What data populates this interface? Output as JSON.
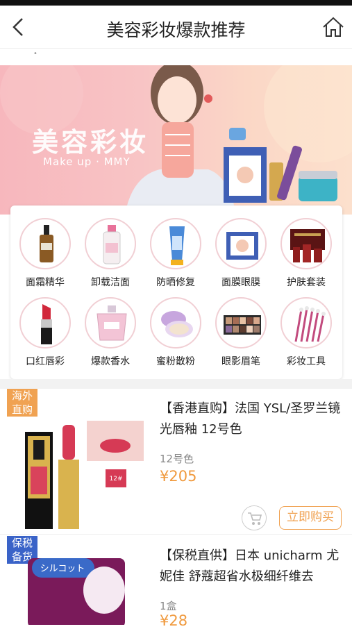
{
  "header": {
    "title": "美容彩妆爆款推荐",
    "back_icon": "chevron-left-icon",
    "home_icon": "home-icon"
  },
  "banner": {
    "title": "美容彩妆",
    "subtitle": "Make up · MMY"
  },
  "categories": [
    {
      "label": "面霜精华",
      "icon": "serum-bottle-icon"
    },
    {
      "label": "卸载洁面",
      "icon": "cleanser-bottle-icon"
    },
    {
      "label": "防晒修复",
      "icon": "sunscreen-tube-icon"
    },
    {
      "label": "面膜眼膜",
      "icon": "face-mask-box-icon"
    },
    {
      "label": "护肤套装",
      "icon": "skincare-set-icon"
    },
    {
      "label": "口红唇彩",
      "icon": "lipstick-icon"
    },
    {
      "label": "爆款香水",
      "icon": "perfume-icon"
    },
    {
      "label": "蜜粉散粉",
      "icon": "powder-compact-icon"
    },
    {
      "label": "眼影眉笔",
      "icon": "eyeshadow-palette-icon"
    },
    {
      "label": "彩妆工具",
      "icon": "makeup-brushes-icon"
    }
  ],
  "products": [
    {
      "badge_line1": "海外",
      "badge_line2": "直购",
      "name": "【香港直购】法国 YSL/圣罗兰镜光唇釉 12号色",
      "spec": "12号色",
      "price": "¥205",
      "buy_label": "立即购买",
      "image_tag": "12#"
    },
    {
      "badge_line1": "保税",
      "badge_line2": "备货",
      "name": "【保税直供】日本 unicharm 尤妮佳 舒蔻超省水极细纤维去",
      "spec": "1盒",
      "price": "¥28",
      "image_label": "シルコット"
    }
  ],
  "colors": {
    "accent": "#f0a252",
    "banner_pink": "#f7b7bd",
    "bonded_blue": "#3a63c8"
  }
}
